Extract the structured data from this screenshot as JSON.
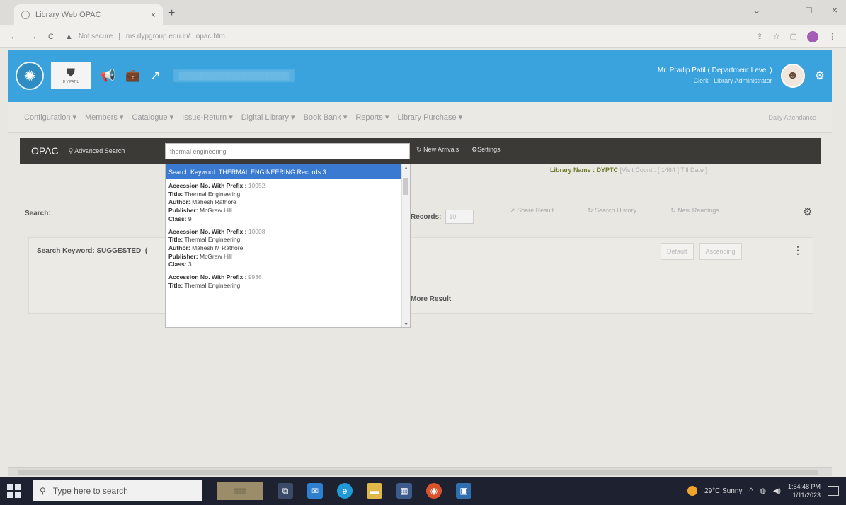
{
  "browser": {
    "tab_title": "Library Web OPAC",
    "tab_close": "×",
    "new_tab": "+",
    "url_warning": "Not secure",
    "url": "ms.dypgroup.edu.in/...opac.htm",
    "window_controls": [
      "⌄",
      "–",
      "□",
      "×"
    ]
  },
  "header": {
    "user_name": "Mr. Pradip Patil ( Department Level )",
    "user_role": "Clerk : Library Administrator"
  },
  "menu": {
    "items": [
      "Configuration ▾",
      "Members ▾",
      "Catalogue ▾",
      "Issue-Return ▾",
      "Digital Library ▾",
      "Book Bank ▾",
      "Reports ▾",
      "Library Purchase ▾"
    ],
    "right_text": "Daily Attendance"
  },
  "opac": {
    "title": "OPAC",
    "advanced_search": "Advanced Search",
    "search_value": "thermal engineering",
    "new_arrivals": "New Arrivals",
    "settings": "Settings"
  },
  "dropdown": {
    "header": "Search Keyword: THERMAL ENGINEERING Records:3",
    "records": [
      {
        "acc_label": "Accession No. With Prefix :",
        "acc": "10952",
        "title_label": "Title:",
        "title": "Thermal Engineering",
        "author_label": "Author:",
        "author": "Mahesh Rathore",
        "publisher_label": "Publisher:",
        "publisher": "McGraw Hill",
        "class_label": "Class:",
        "class": "9"
      },
      {
        "acc_label": "Accession No. With Prefix :",
        "acc": "10008",
        "title_label": "Title:",
        "title": "Thermal Engineering",
        "author_label": "Author:",
        "author": "Mahesh M Rathore",
        "publisher_label": "Publisher:",
        "publisher": "McGraw Hill",
        "class_label": "Class:",
        "class": "3"
      },
      {
        "acc_label": "Accession No. With Prefix :",
        "acc": "9936",
        "title_label": "Title:",
        "title": "Thermal Engineering"
      }
    ]
  },
  "main": {
    "library_label": "Library Name :",
    "library_value": "DYPTC",
    "visit_info": "[Visit Count : [ 1464 ] Till Date ]",
    "search_label": "Search:",
    "records_label": "Records:",
    "records_value": "10",
    "share_result": "Share Result",
    "search_history": "Search History",
    "new_readings": "New Readings",
    "keyword_label": "Search Keyword: SUGGESTED_(",
    "default_btn": "Default",
    "ascending_btn": "Ascending",
    "more_result": "More Result"
  },
  "taskbar": {
    "search_placeholder": "Type here to search",
    "weather": "29°C Sunny",
    "time": "1:54:48 PM",
    "date": "1/11/2023"
  }
}
